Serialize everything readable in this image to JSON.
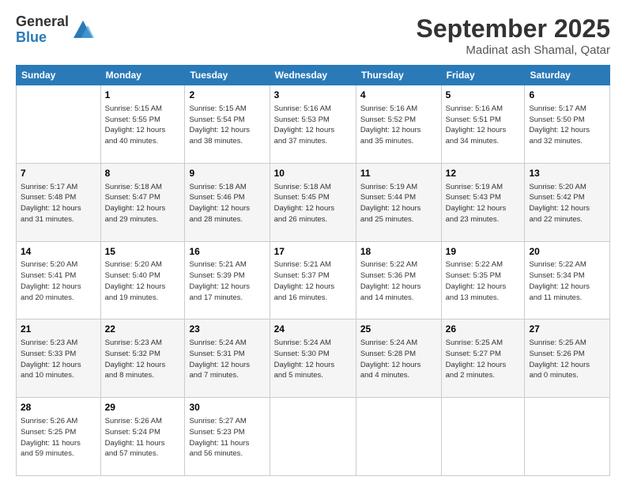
{
  "logo": {
    "general": "General",
    "blue": "Blue"
  },
  "header": {
    "month": "September 2025",
    "location": "Madinat ash Shamal, Qatar"
  },
  "weekdays": [
    "Sunday",
    "Monday",
    "Tuesday",
    "Wednesday",
    "Thursday",
    "Friday",
    "Saturday"
  ],
  "weeks": [
    [
      {
        "day": "",
        "info": ""
      },
      {
        "day": "1",
        "info": "Sunrise: 5:15 AM\nSunset: 5:55 PM\nDaylight: 12 hours\nand 40 minutes."
      },
      {
        "day": "2",
        "info": "Sunrise: 5:15 AM\nSunset: 5:54 PM\nDaylight: 12 hours\nand 38 minutes."
      },
      {
        "day": "3",
        "info": "Sunrise: 5:16 AM\nSunset: 5:53 PM\nDaylight: 12 hours\nand 37 minutes."
      },
      {
        "day": "4",
        "info": "Sunrise: 5:16 AM\nSunset: 5:52 PM\nDaylight: 12 hours\nand 35 minutes."
      },
      {
        "day": "5",
        "info": "Sunrise: 5:16 AM\nSunset: 5:51 PM\nDaylight: 12 hours\nand 34 minutes."
      },
      {
        "day": "6",
        "info": "Sunrise: 5:17 AM\nSunset: 5:50 PM\nDaylight: 12 hours\nand 32 minutes."
      }
    ],
    [
      {
        "day": "7",
        "info": "Sunrise: 5:17 AM\nSunset: 5:48 PM\nDaylight: 12 hours\nand 31 minutes."
      },
      {
        "day": "8",
        "info": "Sunrise: 5:18 AM\nSunset: 5:47 PM\nDaylight: 12 hours\nand 29 minutes."
      },
      {
        "day": "9",
        "info": "Sunrise: 5:18 AM\nSunset: 5:46 PM\nDaylight: 12 hours\nand 28 minutes."
      },
      {
        "day": "10",
        "info": "Sunrise: 5:18 AM\nSunset: 5:45 PM\nDaylight: 12 hours\nand 26 minutes."
      },
      {
        "day": "11",
        "info": "Sunrise: 5:19 AM\nSunset: 5:44 PM\nDaylight: 12 hours\nand 25 minutes."
      },
      {
        "day": "12",
        "info": "Sunrise: 5:19 AM\nSunset: 5:43 PM\nDaylight: 12 hours\nand 23 minutes."
      },
      {
        "day": "13",
        "info": "Sunrise: 5:20 AM\nSunset: 5:42 PM\nDaylight: 12 hours\nand 22 minutes."
      }
    ],
    [
      {
        "day": "14",
        "info": "Sunrise: 5:20 AM\nSunset: 5:41 PM\nDaylight: 12 hours\nand 20 minutes."
      },
      {
        "day": "15",
        "info": "Sunrise: 5:20 AM\nSunset: 5:40 PM\nDaylight: 12 hours\nand 19 minutes."
      },
      {
        "day": "16",
        "info": "Sunrise: 5:21 AM\nSunset: 5:39 PM\nDaylight: 12 hours\nand 17 minutes."
      },
      {
        "day": "17",
        "info": "Sunrise: 5:21 AM\nSunset: 5:37 PM\nDaylight: 12 hours\nand 16 minutes."
      },
      {
        "day": "18",
        "info": "Sunrise: 5:22 AM\nSunset: 5:36 PM\nDaylight: 12 hours\nand 14 minutes."
      },
      {
        "day": "19",
        "info": "Sunrise: 5:22 AM\nSunset: 5:35 PM\nDaylight: 12 hours\nand 13 minutes."
      },
      {
        "day": "20",
        "info": "Sunrise: 5:22 AM\nSunset: 5:34 PM\nDaylight: 12 hours\nand 11 minutes."
      }
    ],
    [
      {
        "day": "21",
        "info": "Sunrise: 5:23 AM\nSunset: 5:33 PM\nDaylight: 12 hours\nand 10 minutes."
      },
      {
        "day": "22",
        "info": "Sunrise: 5:23 AM\nSunset: 5:32 PM\nDaylight: 12 hours\nand 8 minutes."
      },
      {
        "day": "23",
        "info": "Sunrise: 5:24 AM\nSunset: 5:31 PM\nDaylight: 12 hours\nand 7 minutes."
      },
      {
        "day": "24",
        "info": "Sunrise: 5:24 AM\nSunset: 5:30 PM\nDaylight: 12 hours\nand 5 minutes."
      },
      {
        "day": "25",
        "info": "Sunrise: 5:24 AM\nSunset: 5:28 PM\nDaylight: 12 hours\nand 4 minutes."
      },
      {
        "day": "26",
        "info": "Sunrise: 5:25 AM\nSunset: 5:27 PM\nDaylight: 12 hours\nand 2 minutes."
      },
      {
        "day": "27",
        "info": "Sunrise: 5:25 AM\nSunset: 5:26 PM\nDaylight: 12 hours\nand 0 minutes."
      }
    ],
    [
      {
        "day": "28",
        "info": "Sunrise: 5:26 AM\nSunset: 5:25 PM\nDaylight: 11 hours\nand 59 minutes."
      },
      {
        "day": "29",
        "info": "Sunrise: 5:26 AM\nSunset: 5:24 PM\nDaylight: 11 hours\nand 57 minutes."
      },
      {
        "day": "30",
        "info": "Sunrise: 5:27 AM\nSunset: 5:23 PM\nDaylight: 11 hours\nand 56 minutes."
      },
      {
        "day": "",
        "info": ""
      },
      {
        "day": "",
        "info": ""
      },
      {
        "day": "",
        "info": ""
      },
      {
        "day": "",
        "info": ""
      }
    ]
  ]
}
